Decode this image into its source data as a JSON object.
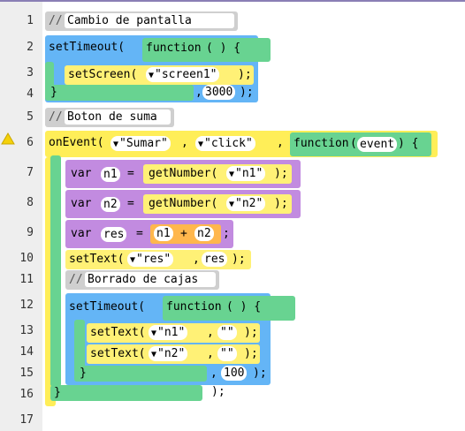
{
  "gutter": {
    "line_numbers": [
      "1",
      "2",
      "3",
      "4",
      "5",
      "6",
      "7",
      "8",
      "9",
      "10",
      "11",
      "12",
      "13",
      "14",
      "15",
      "16",
      "17"
    ]
  },
  "code": {
    "l1": {
      "comment_slashes": "//",
      "comment": "Cambio de pantalla"
    },
    "l2": {
      "fn": "setTimeout(",
      "function_kw": "function",
      "parens": "( ) {"
    },
    "l3": {
      "fn": "setScreen(",
      "arg": "\"screen1\"",
      "close": ");"
    },
    "l4": {
      "brace": "}",
      "comma": ",",
      "num": "3000",
      "close": ");"
    },
    "l5": {
      "comment_slashes": "//",
      "comment": "Boton de suma"
    },
    "l6": {
      "fn": "onEvent(",
      "arg1": "\"Sumar\"",
      "comma1": ",",
      "arg2": "\"click\"",
      "comma2": ",",
      "function_kw": "function",
      "param_open": "(",
      "param": "event",
      "param_close": ") {"
    },
    "l7": {
      "var": "var",
      "name": "n1",
      "eq": "=",
      "fn": "getNumber(",
      "arg": "\"n1\"",
      "close": ");"
    },
    "l8": {
      "var": "var",
      "name": "n2",
      "eq": "=",
      "fn": "getNumber(",
      "arg": "\"n2\"",
      "close": ");"
    },
    "l9": {
      "var": "var",
      "name": "res",
      "eq": "=",
      "a": "n1",
      "plus": "+",
      "b": "n2",
      "close": ";"
    },
    "l10": {
      "fn": "setText(",
      "arg1": "\"res\"",
      "comma": ",",
      "arg2": "res",
      "close": ");"
    },
    "l11": {
      "comment_slashes": "//",
      "comment": "Borrado de cajas"
    },
    "l12": {
      "fn": "setTimeout(",
      "function_kw": "function",
      "parens": "( ) {"
    },
    "l13": {
      "fn": "setText(",
      "arg1": "\"n1\"",
      "comma": ",",
      "arg2": "\"\"",
      "close": ");"
    },
    "l14": {
      "fn": "setText(",
      "arg1": "\"n2\"",
      "comma": ",",
      "arg2": "\"\"",
      "close": ");"
    },
    "l15": {
      "brace": "}",
      "comma": ",",
      "num": "100",
      "close": ");"
    },
    "l16": {
      "brace": "}",
      "close": ");"
    }
  },
  "colors": {
    "gutter": "#eeeeee",
    "timeout": "#64b5f6",
    "function": "#68d391",
    "call": "#fff176",
    "var": "#c28be0",
    "comment": "#cfcfcf",
    "operator": "#ffb74d",
    "warning": "#f5d10a"
  },
  "icons": {
    "dropdown": "triangle-down-icon",
    "warning": "warning-icon"
  }
}
